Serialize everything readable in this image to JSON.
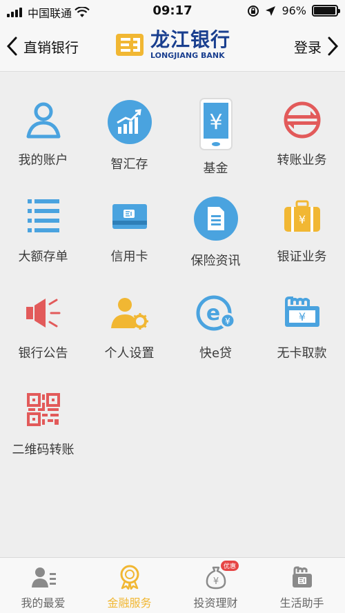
{
  "status_bar": {
    "carrier": "中国联通",
    "time": "09:17",
    "battery": "96%",
    "battery_level": 0.96
  },
  "nav": {
    "back_label": "直销银行",
    "brand_cn": "龙江银行",
    "brand_en": "LONGJIANG BANK",
    "login_label": "登录"
  },
  "grid": [
    {
      "label": "我的账户",
      "icon": "user-icon",
      "color": "#4aa3df"
    },
    {
      "label": "智汇存",
      "icon": "chart-growth-icon",
      "color": "#4aa3df"
    },
    {
      "label": "基金",
      "icon": "phone-yuan-icon",
      "color": "#4aa3df"
    },
    {
      "label": "转账业务",
      "icon": "transfer-icon",
      "color": "#e25a5a"
    },
    {
      "label": "大额存单",
      "icon": "list-icon",
      "color": "#4aa3df"
    },
    {
      "label": "信用卡",
      "icon": "credit-card-icon",
      "color": "#4aa3df"
    },
    {
      "label": "保险资讯",
      "icon": "document-icon",
      "color": "#4aa3df"
    },
    {
      "label": "银证业务",
      "icon": "briefcase-icon",
      "color": "#f1b733"
    },
    {
      "label": "银行公告",
      "icon": "megaphone-icon",
      "color": "#e25a5a"
    },
    {
      "label": "个人设置",
      "icon": "user-settings-icon",
      "color": "#f1b733"
    },
    {
      "label": "快e贷",
      "icon": "e-loan-icon",
      "color": "#4aa3df"
    },
    {
      "label": "无卡取款",
      "icon": "cardless-withdraw-icon",
      "color": "#4aa3df"
    },
    {
      "label": "二维码转账",
      "icon": "qr-code-icon",
      "color": "#e25a5a"
    }
  ],
  "tabs": [
    {
      "label": "我的最爱",
      "icon": "favorites-icon",
      "active": false
    },
    {
      "label": "金融服务",
      "icon": "finance-service-icon",
      "active": true
    },
    {
      "label": "投资理财",
      "icon": "investment-icon",
      "active": false,
      "badge": "优惠"
    },
    {
      "label": "生活助手",
      "icon": "life-assistant-icon",
      "active": false
    }
  ]
}
